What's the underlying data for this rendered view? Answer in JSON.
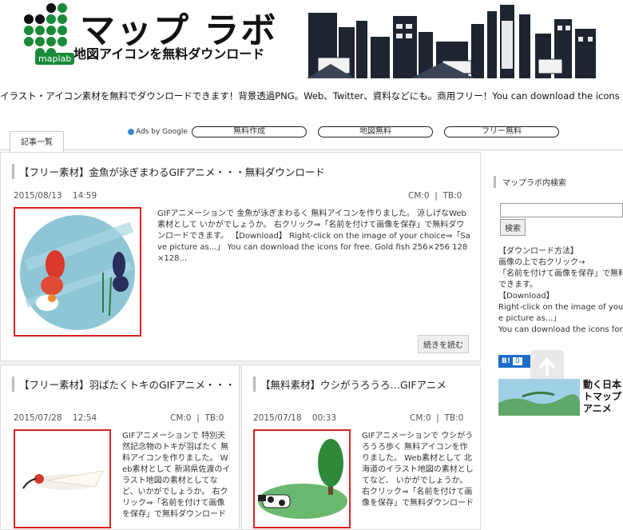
{
  "header": {
    "logo_title": "マップ ラボ",
    "logo_subtitle": "地図アイコンを無料ダウンロード",
    "logo_mini": "maplab",
    "tagline": "イラスト・アイコン素材を無料でダウンロードできます！背景透過PNG。Web、Twitter、資料などにも。商用フリー！You can download the icons for free."
  },
  "nav": {
    "tab": "記事一覧",
    "ads_label": "Ads by Google",
    "pills": [
      "無料作成",
      "地図無料",
      "フリー無料"
    ]
  },
  "posts": [
    {
      "title": "【フリー素材】金魚が泳ぎまわるGIFアニメ・・・無料ダウンロード",
      "date": "2015/08/13",
      "time": "14:59",
      "cm": "CM:0",
      "tb": "TB:0",
      "excerpt": "GIFアニメーションで 金魚が泳ぎまわるく 無料アイコンを作りました。 涼しげなWeb素材として いかがでしょうか。 右クリック⇒「名前を付けて画像を保存」で無料ダウンロードできます。 【Download】 Right-click on the image of your choice⇒「Save picture as...」 You can download the icons for free. Gold fish 256×256 128×128...",
      "more": "続きを読む"
    },
    {
      "title": "【フリー素材】羽ばたくトキのGIFアニメ・・・無料ダウンロード",
      "date": "2015/07/28",
      "time": "12:54",
      "cm": "CM:0",
      "tb": "TB:0",
      "excerpt": "GIFアニメーションで 特別天然記念物のトキが羽ばたく 無料アイコンを作りました。 Web素材として 新潟県佐渡のイラスト地図の素材としてなど、いかがでしょうか。 右クリック⇒「名前を付けて画像を保存」で無料ダウンロード"
    },
    {
      "title": "【無料素材】ウシがうろうろ…GIFアニメ",
      "date": "2015/07/18",
      "time": "00:33",
      "cm": "CM:0",
      "tb": "TB:0",
      "excerpt": "GIFアニメーションで ウシがうろうろ歩く 無料アイコンを作りました。 Web素材として 北海道のイラスト地図の素材としてなど、 いかがでしょうか。 右クリック⇒「名前を付けて画像を保存」で無料ダウンロード"
    }
  ],
  "sidebar": {
    "search_title": "マップラボ内検索",
    "search_button": "検索",
    "howto": "【ダウンロード方法】\n画像の上で右クリック→\n「名前を付けて画像を保存」で無料\nできます。\n【Download】\nRight-click on the image of your\ne picture as...」\nYou can download the icons for f",
    "hatena_label": "B!",
    "hatena_count": "0",
    "ad_title": "動く日本トマップアニメ"
  },
  "colors": {
    "accent_red": "#e02020",
    "logo_green": "#1a8a3a",
    "hatena_blue": "#1d6ec8"
  }
}
